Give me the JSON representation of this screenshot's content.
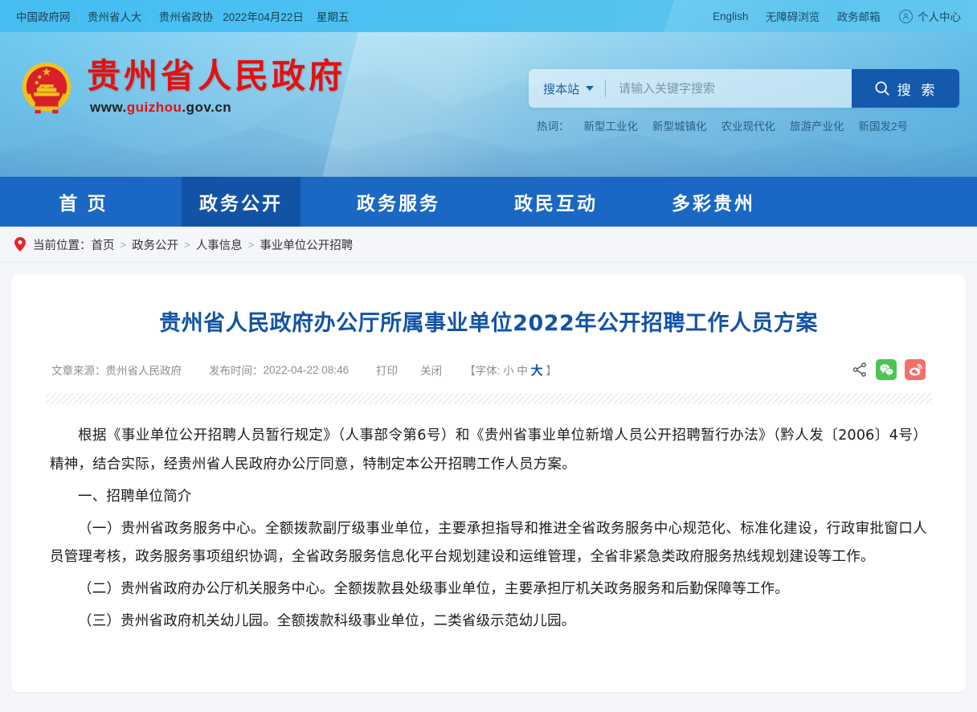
{
  "topbar": {
    "links": [
      "中国政府网",
      "贵州省人大",
      "贵州省政协"
    ],
    "date": "2022年04月22日",
    "weekday": "星期五",
    "right_links": [
      "English",
      "无障碍浏览",
      "政务邮箱"
    ],
    "user_center": "个人中心",
    "user_icon": "user-circle-icon",
    "separator": "|"
  },
  "header": {
    "emblem_alt": "national-emblem-icon",
    "site_title": "贵州省人民政府",
    "url_www": "www.",
    "url_name": "guizhou",
    "url_tld": ".gov.cn",
    "search": {
      "scope_label": "搜本站",
      "scope_caret": "chevron-down-icon",
      "placeholder": "请输入关键字搜索",
      "value": "",
      "button_label": "搜 索",
      "button_icon": "search-icon"
    },
    "hotwords_label": "热词：",
    "hotwords": [
      "新型工业化",
      "新型城镇化",
      "农业现代化",
      "旅游产业化",
      "新国发2号"
    ]
  },
  "nav": {
    "items": [
      {
        "label": "首 页",
        "active": false
      },
      {
        "label": "政务公开",
        "active": true
      },
      {
        "label": "政务服务",
        "active": false
      },
      {
        "label": "政民互动",
        "active": false
      },
      {
        "label": "多彩贵州",
        "active": false
      }
    ]
  },
  "breadcrumb": {
    "pin_icon": "location-pin-icon",
    "label": "当前位置：",
    "items": [
      "首页",
      "政务公开",
      "人事信息",
      "事业单位公开招聘"
    ],
    "separator": ">"
  },
  "article": {
    "title": "贵州省人民政府办公厅所属事业单位2022年公开招聘工作人员方案",
    "meta": {
      "source_label": "文章来源：",
      "source_value": "贵州省人民政府",
      "time_label": "发布时间：",
      "time_value": "2022-04-22 08:46",
      "print": "打印",
      "close": "关闭",
      "font_prefix": "【字体:",
      "font_small": "小",
      "font_medium": "中",
      "font_large": "大",
      "font_suffix": "】",
      "share_icon": "share-nodes-icon",
      "wechat_icon": "wechat-icon",
      "weibo_icon": "weibo-icon"
    },
    "paragraphs": [
      "根据《事业单位公开招聘人员暂行规定》（人事部令第6号）和《贵州省事业单位新增人员公开招聘暂行办法》（黔人发〔2006〕4号）精神，结合实际，经贵州省人民政府办公厅同意，特制定本公开招聘工作人员方案。",
      "一、招聘单位简介",
      "（一）贵州省政务服务中心。全额拨款副厅级事业单位，主要承担指导和推进全省政务服务中心规范化、标准化建设，行政审批窗口人员管理考核，政务服务事项组织协调，全省政务服务信息化平台规划建设和运维管理，全省非紧急类政府服务热线规划建设等工作。",
      "（二）贵州省政府办公厅机关服务中心。全额拨款县处级事业单位，主要承担厅机关政务服务和后勤保障等工作。",
      "（三）贵州省政府机关幼儿园。全额拨款科级事业单位，二类省级示范幼儿园。"
    ]
  },
  "colors": {
    "brand_red": "#e3110f",
    "nav_blue": "#1a67c4",
    "nav_active": "#1353a5",
    "title_blue": "#1353a5",
    "search_btn": "#1559ad",
    "wechat_green": "#4bc552",
    "weibo_red": "#f2706b"
  }
}
